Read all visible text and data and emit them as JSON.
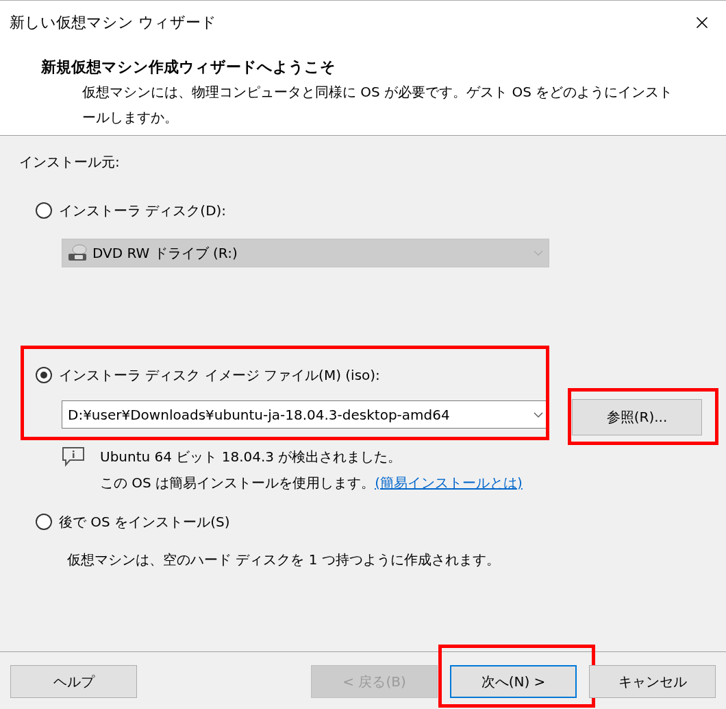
{
  "window": {
    "title": "新しい仮想マシン ウィザード"
  },
  "header": {
    "title": "新規仮想マシン作成ウィザードへようこそ",
    "description": "仮想マシンには、物理コンピュータと同様に OS が必要です。ゲスト OS をどのようにインストールしますか。"
  },
  "source_label": "インストール元:",
  "options": [
    {
      "kind": "drive",
      "label": "インストーラ ディスク(D):",
      "selected": false,
      "highlighted": false,
      "dropdown": {
        "value": "DVD RW ドライブ (R:)",
        "disabled": true
      }
    },
    {
      "kind": "iso",
      "label": "インストーラ ディスク イメージ ファイル(M) (iso):",
      "selected": true,
      "highlighted": true,
      "dropdown": {
        "value": "D:¥user¥Downloads¥ubuntu-ja-18.04.3-desktop-amd64",
        "disabled": false
      },
      "browse_button": {
        "label": "参照(R)...",
        "highlighted": true
      },
      "info": {
        "detected": "Ubuntu 64 ビット 18.04.3 が検出されました。",
        "note": "この OS は簡易インストールを使用します。",
        "link": "(簡易インストールとは)"
      }
    },
    {
      "kind": "later",
      "label": "後で OS をインストール(S)",
      "selected": false,
      "highlighted": false,
      "note": "仮想マシンは、空のハード ディスクを 1 つ持つように作成されます。"
    }
  ],
  "buttons": [
    {
      "label": "ヘルプ",
      "disabled": false,
      "default": false,
      "highlighted": false
    },
    {
      "label": "< 戻る(B)",
      "disabled": true,
      "default": false,
      "highlighted": false
    },
    {
      "label": "次へ(N) >",
      "disabled": false,
      "default": true,
      "highlighted": true
    },
    {
      "label": "キャンセル",
      "disabled": false,
      "default": false,
      "highlighted": false
    }
  ]
}
